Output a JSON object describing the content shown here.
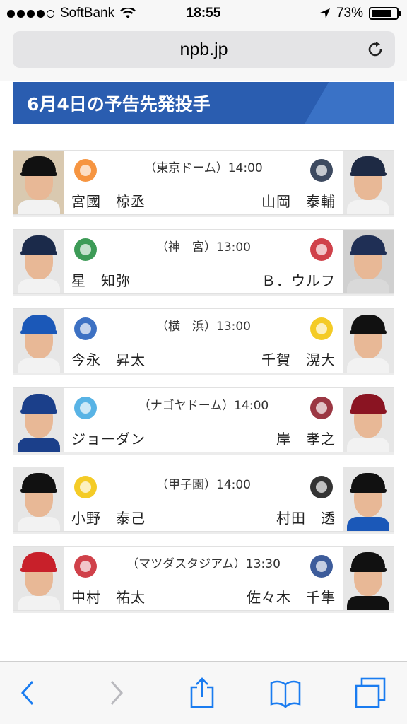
{
  "status": {
    "carrier": "SoftBank",
    "time": "18:55",
    "battery": "73%",
    "signal_bars": 4,
    "battery_level": 0.73
  },
  "browser": {
    "url": "npb.jp"
  },
  "heading": "6月4日の予告先発投手",
  "games": [
    {
      "venue": "（東京ドーム）14:00",
      "home_pitcher": "宮國　椋丞",
      "away_pitcher": "山岡　泰輔",
      "home_team_logo": "giants-logo",
      "away_team_logo": "buffaloes-logo"
    },
    {
      "venue": "（神　宮）13:00",
      "home_pitcher": "星　知弥",
      "away_pitcher": "Ｂ．ウルフ",
      "home_team_logo": "swallows-logo",
      "away_team_logo": "lions-logo"
    },
    {
      "venue": "（横　浜）13:00",
      "home_pitcher": "今永　昇太",
      "away_pitcher": "千賀　滉大",
      "home_team_logo": "baystars-logo",
      "away_team_logo": "hawks-logo"
    },
    {
      "venue": "（ナゴヤドーム）14:00",
      "home_pitcher": "ジョーダン",
      "away_pitcher": "岸　孝之",
      "home_team_logo": "dragons-logo",
      "away_team_logo": "eagles-logo"
    },
    {
      "venue": "（甲子園）14:00",
      "home_pitcher": "小野　泰己",
      "away_pitcher": "村田　透",
      "home_team_logo": "tigers-logo",
      "away_team_logo": "fighters-logo"
    },
    {
      "venue": "（マツダスタジアム）13:30",
      "home_pitcher": "中村　祐太",
      "away_pitcher": "佐々木　千隼",
      "home_team_logo": "carp-logo",
      "away_team_logo": "marines-logo"
    }
  ],
  "colors": {
    "accent": "#2a5db0",
    "ios_blue": "#1a7cf0"
  }
}
